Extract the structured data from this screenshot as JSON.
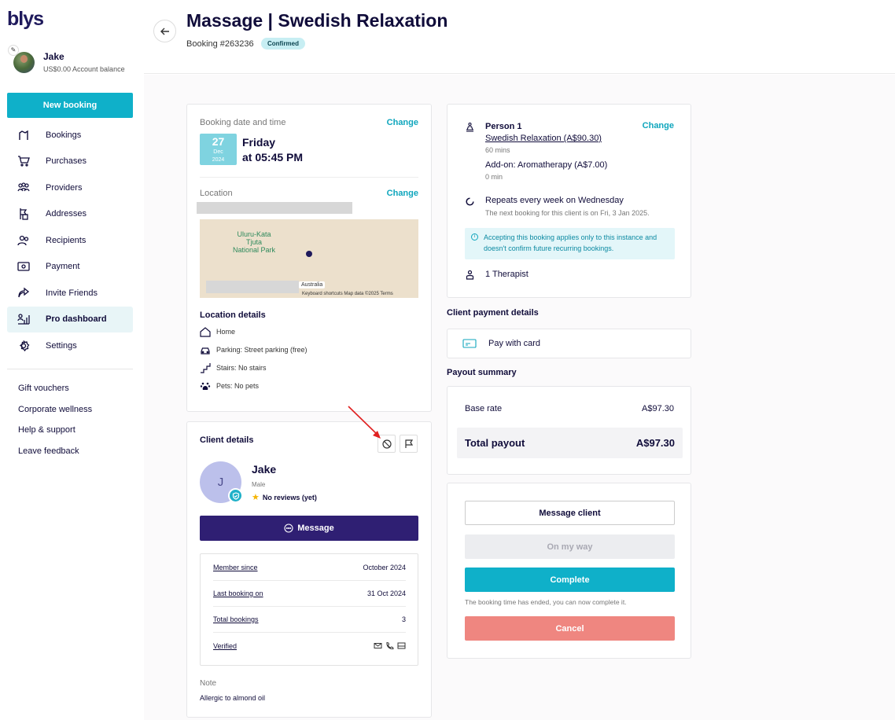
{
  "sidebar": {
    "logo": "blys",
    "user": {
      "name": "Jake",
      "balance": "US$0.00 Account balance"
    },
    "new_booking_label": "New booking",
    "items": [
      {
        "label": "Bookings",
        "icon": "bookings-icon"
      },
      {
        "label": "Purchases",
        "icon": "cart-icon"
      },
      {
        "label": "Providers",
        "icon": "providers-icon"
      },
      {
        "label": "Addresses",
        "icon": "address-icon"
      },
      {
        "label": "Recipients",
        "icon": "recipients-icon"
      },
      {
        "label": "Payment",
        "icon": "payment-icon"
      },
      {
        "label": "Invite Friends",
        "icon": "share-icon"
      },
      {
        "label": "Pro dashboard",
        "icon": "dashboard-icon",
        "active": true
      },
      {
        "label": "Settings",
        "icon": "gear-icon"
      }
    ],
    "links": [
      "Gift vouchers",
      "Corporate wellness",
      "Help & support",
      "Leave feedback"
    ]
  },
  "header": {
    "title": "Massage | Swedish Relaxation",
    "booking_number": "Booking #263236",
    "status": "Confirmed"
  },
  "booking_card": {
    "date_label": "Booking date and time",
    "change_label": "Change",
    "date_day": "27",
    "date_month": "Dec",
    "date_year": "2024",
    "weekday": "Friday",
    "time": "at 05:45 PM",
    "location_label": "Location",
    "map": {
      "place_line1": "Uluru-Kata",
      "place_line2": "Tjuta",
      "place_line3": "National Park",
      "country": "Australia",
      "footer": "Keyboard shortcuts    Map data ©2025    Terms"
    },
    "location_details_title": "Location details",
    "details": [
      "Home",
      "Parking: Street parking (free)",
      "Stairs: No stairs",
      "Pets: No pets"
    ]
  },
  "client_card": {
    "title": "Client details",
    "avatar_initial": "J",
    "name": "Jake",
    "gender": "Male",
    "reviews": "No reviews (yet)",
    "message_label": "Message",
    "rows": [
      {
        "label": "Member since",
        "value": "October 2024"
      },
      {
        "label": "Last booking on",
        "value": "31 Oct 2024"
      },
      {
        "label": "Total bookings",
        "value": "3"
      },
      {
        "label": "Verified",
        "value": ""
      }
    ],
    "note_label": "Note",
    "note_text": "Allergic to almond oil"
  },
  "service_card": {
    "person_label": "Person 1",
    "change_label": "Change",
    "service": "Swedish Relaxation (A$90.30)",
    "duration": "60 mins",
    "addon": "Add-on: Aromatherapy (A$7.00)",
    "addon_duration": "0 min",
    "repeat_title": "Repeats every week on Wednesday",
    "repeat_sub": "The next booking for this client is on Fri, 3 Jan 2025.",
    "info": "Accepting this booking applies only to this instance and doesn't confirm future recurring bookings.",
    "therapists": "1 Therapist"
  },
  "payment": {
    "title": "Client payment details",
    "method": "Pay with card"
  },
  "payout": {
    "title": "Payout summary",
    "base_label": "Base rate",
    "base_value": "A$97.30",
    "total_label": "Total payout",
    "total_value": "A$97.30"
  },
  "actions": {
    "message_client": "Message client",
    "on_my_way": "On my way",
    "complete": "Complete",
    "complete_hint": "The booking time has ended, you can now complete it.",
    "cancel": "Cancel"
  },
  "colors": {
    "teal": "#0fb0c9",
    "navy": "#2f1f73",
    "cancel": "#ef8680",
    "confirmed_badge": "#c7eef3"
  }
}
